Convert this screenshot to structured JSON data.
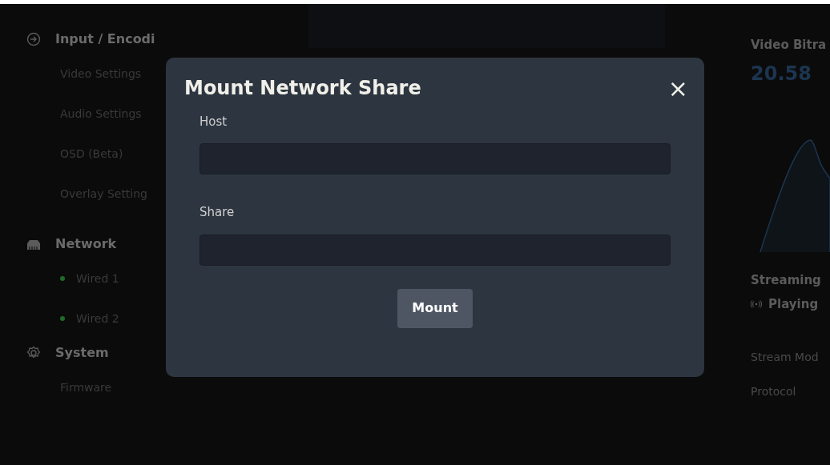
{
  "sidebar": [
    {
      "label": "Input / Encodi",
      "items": [
        {
          "label": "Video Settings"
        },
        {
          "label": "Audio Settings"
        },
        {
          "label": "OSD (Beta)"
        },
        {
          "label": "Overlay Setting"
        }
      ]
    },
    {
      "label": "Network",
      "items": [
        {
          "label": "Wired 1",
          "color": "#1f6b2a"
        },
        {
          "label": "Wired 2",
          "color": "#1f6b2a"
        }
      ]
    },
    {
      "label": "System",
      "items": [
        {
          "label": "Firmware"
        }
      ]
    }
  ],
  "stats": {
    "title": "Video Bitra",
    "value": "20.58",
    "streaming_title": "Streaming",
    "streaming_state": "Playing",
    "fields": [
      "Stream Mod",
      "Protocol"
    ]
  },
  "modal": {
    "title": "Mount Network Share",
    "close": "×",
    "fields": [
      {
        "label": "Host"
      },
      {
        "label": "Share"
      }
    ],
    "button": "Mount"
  }
}
